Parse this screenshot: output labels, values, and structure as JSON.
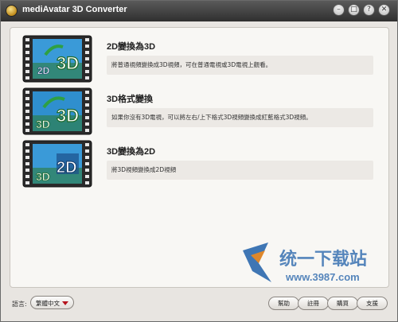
{
  "window": {
    "title": "mediAvatar 3D Converter",
    "controls": {
      "minimize": "–",
      "restore": "□",
      "help": "?",
      "close": "✕"
    }
  },
  "items": [
    {
      "title": "2D變換為3D",
      "description": "將普通視頻變換成3D視頻，可在普通電視或3D電視上觀看。",
      "icon_left": "2D",
      "icon_right": "3D"
    },
    {
      "title": "3D格式變換",
      "description": "如果你沒有3D電視，可以將左右/上下格式3D視頻變換成紅藍格式3D視頻。",
      "icon_left": "3D",
      "icon_right": "3D"
    },
    {
      "title": "3D變換為2D",
      "description": "將3D視頻變換成2D視頻",
      "icon_left": "3D",
      "icon_right": "2D"
    }
  ],
  "watermark": {
    "brand": "统一下载站",
    "url": "www.3987.com"
  },
  "footer": {
    "language_label": "語言:",
    "language_value": "繁體中文",
    "buttons": {
      "help": "幫助",
      "register": "註冊",
      "buy": "購買",
      "support": "支援"
    }
  },
  "colors": {
    "titlebar": "#3a3a3a",
    "panel": "#f8f7f4",
    "desc_bg": "#ece9e5",
    "arrow": "#b5141d",
    "watermark_blue": "#1f5fa8"
  }
}
